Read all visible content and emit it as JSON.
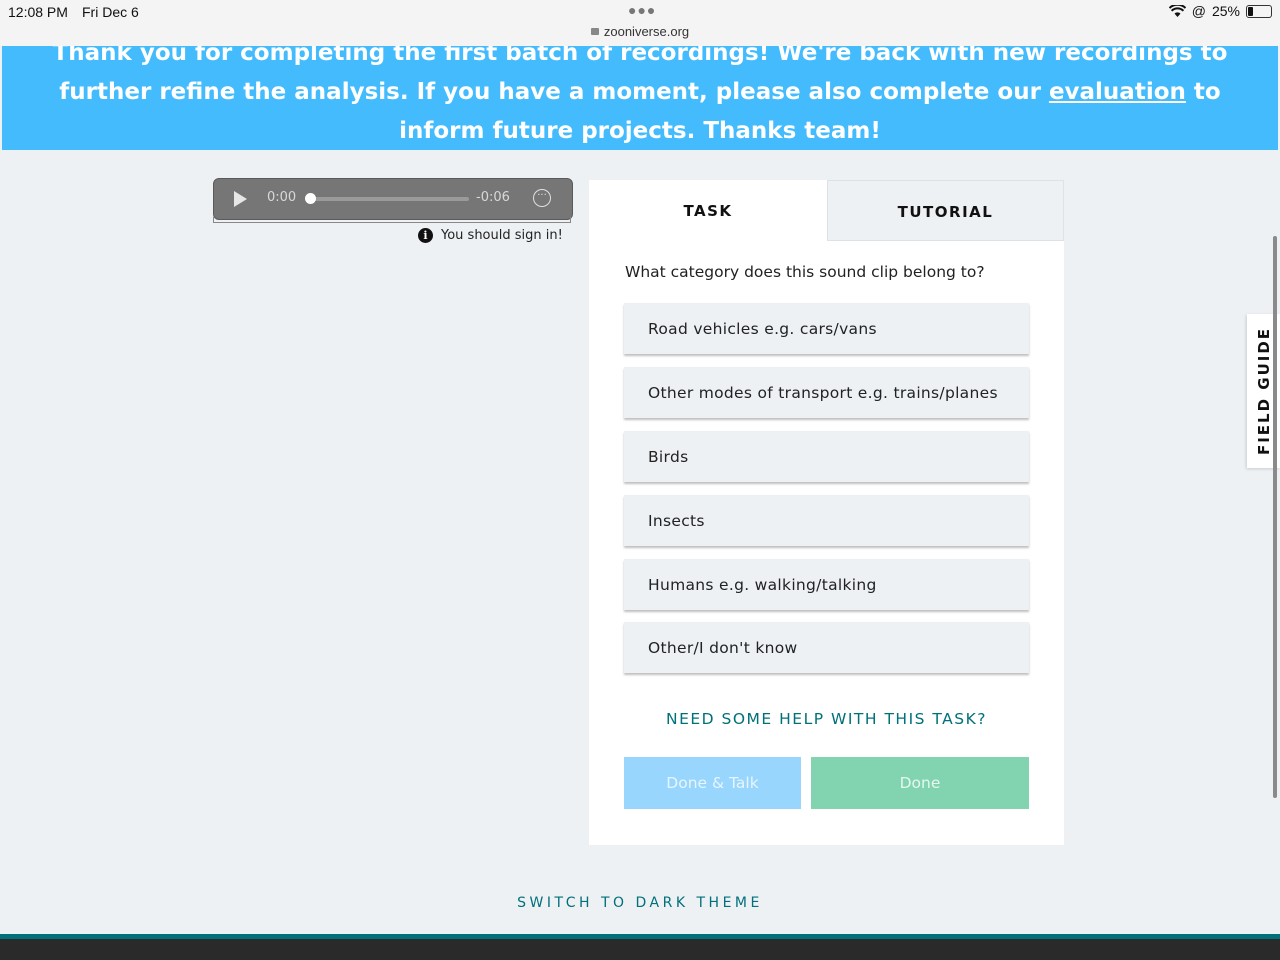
{
  "status_bar": {
    "time": "12:08 PM",
    "date": "Fri Dec 6",
    "url": "zooniverse.org",
    "battery": "25%"
  },
  "banner": {
    "text_before": "Thank you for completing the first batch of recordings! We're back with new recordings to further refine the analysis. If you have a moment, please also complete our ",
    "link": "evaluation",
    "text_after": " to inform future projects. Thanks team!",
    "color": "#43bbfd"
  },
  "audio": {
    "current": "0:00",
    "remaining": "-0:06"
  },
  "signin_notice": "You should sign in!",
  "tabs": {
    "task": "TASK",
    "tutorial": "TUTORIAL"
  },
  "task": {
    "question": "What category does this sound clip belong to?",
    "answers": [
      "Road vehicles e.g. cars/vans",
      "Other modes of transport e.g. trains/planes",
      "Birds",
      "Insects",
      "Humans e.g. walking/talking",
      "Other/I don't know"
    ],
    "help": "NEED SOME HELP WITH THIS TASK?",
    "done_talk": "Done & Talk",
    "done": "Done"
  },
  "field_guide": "FIELD GUIDE",
  "theme_toggle": "SWITCH TO DARK THEME",
  "colors": {
    "accent": "#00707a",
    "done_talk_bg": "#98d6fd",
    "done_bg": "#82d4b0"
  }
}
